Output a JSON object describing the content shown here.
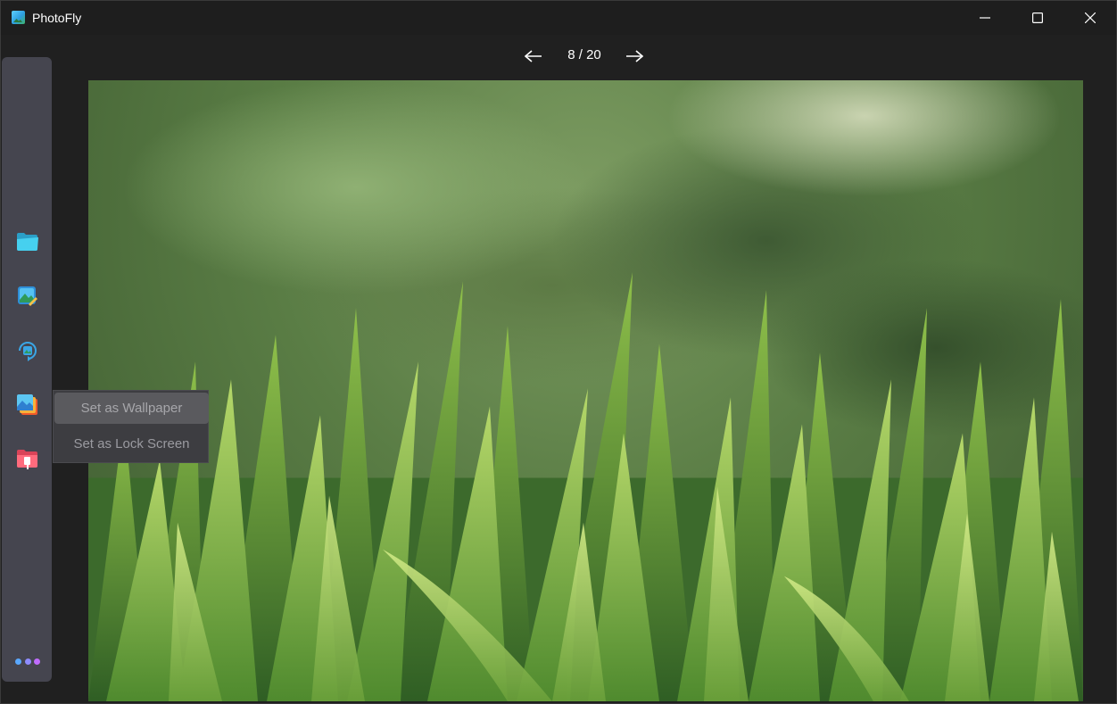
{
  "window": {
    "title": "PhotoFly"
  },
  "titlebar": {
    "buttons": [
      "minimize-icon",
      "maximize-icon",
      "close-icon"
    ]
  },
  "nav": {
    "counter": "8 / 20",
    "current": 8,
    "total": 20
  },
  "sidebar": {
    "items": [
      {
        "icon": "folder-open-icon",
        "color": "#3fc4e8"
      },
      {
        "icon": "image-edit-icon",
        "color": "#35a8e0"
      },
      {
        "icon": "rotate-image-icon",
        "color": "#3aa6e6"
      },
      {
        "icon": "set-wallpaper-icon",
        "color": "#f0a43a"
      },
      {
        "icon": "delete-folder-icon",
        "color": "#f0566a"
      }
    ],
    "more": {
      "icon": "more-dots-icon",
      "colors": [
        "#5aa8ff",
        "#8f8cff",
        "#c06cff"
      ]
    }
  },
  "context_menu": {
    "items": [
      {
        "label": "Set as Wallpaper",
        "hovered": true
      },
      {
        "label": "Set as Lock Screen",
        "hovered": false
      }
    ]
  },
  "colors": {
    "background": "#202020",
    "sidebar": "#45454f",
    "menu": "#3d3d41"
  }
}
